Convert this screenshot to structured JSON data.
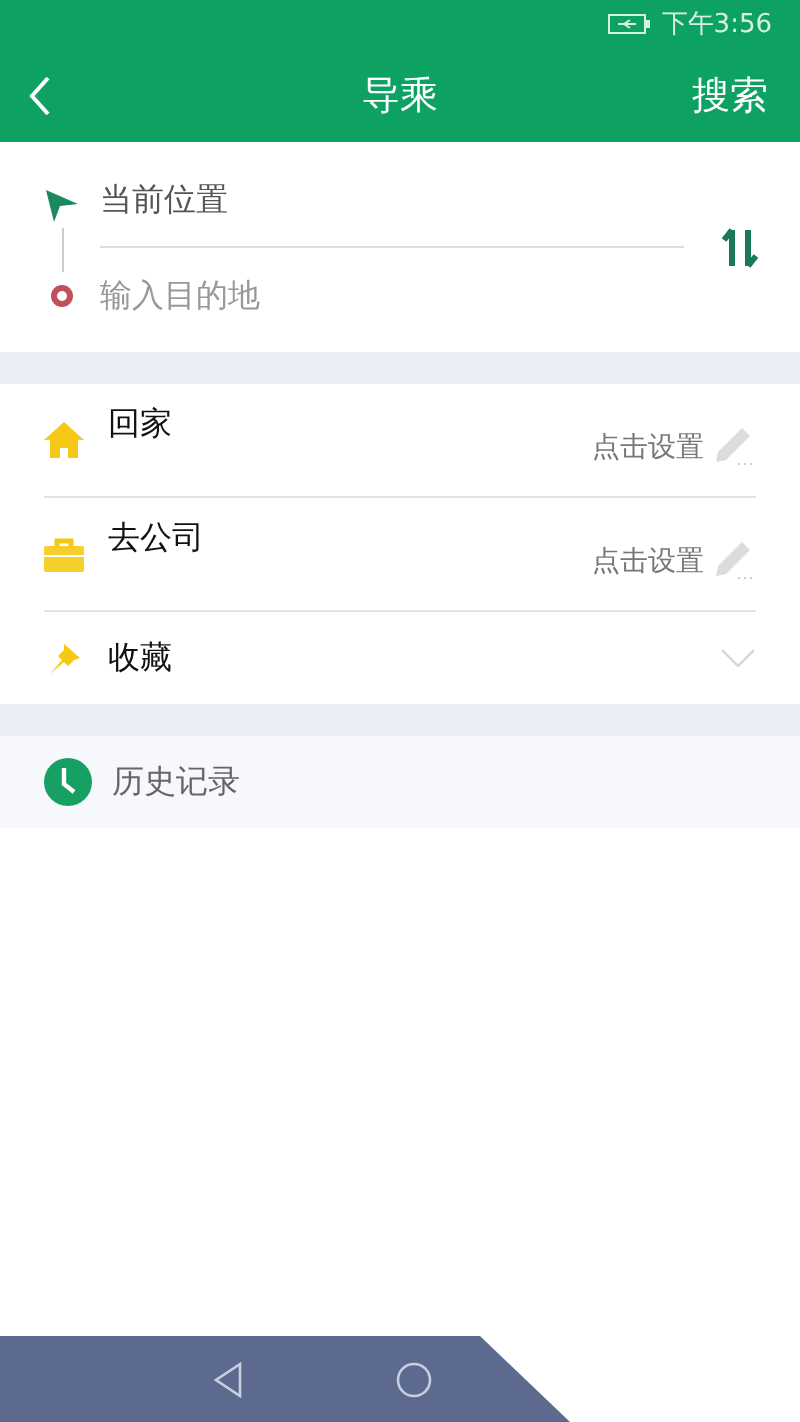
{
  "status_bar": {
    "time": "下午3:56"
  },
  "header": {
    "title": "导乘",
    "action": "搜索"
  },
  "route": {
    "origin": "当前位置",
    "destination_placeholder": "输入目的地"
  },
  "places": [
    {
      "kind": "home",
      "label": "回家",
      "action": "点击设置"
    },
    {
      "kind": "work",
      "label": "去公司",
      "action": "点击设置"
    },
    {
      "kind": "favorites",
      "label": "收藏",
      "expanded": false
    }
  ],
  "history": {
    "label": "历史记录"
  }
}
